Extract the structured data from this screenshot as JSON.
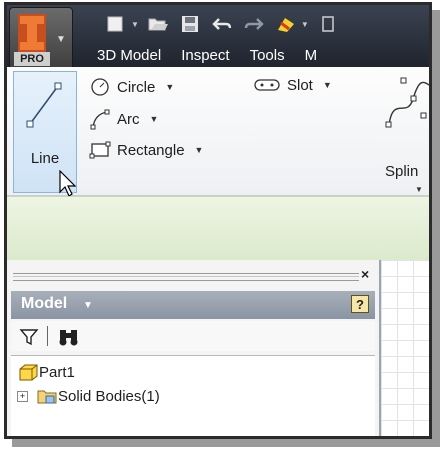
{
  "app": {
    "badge": "PRO",
    "logo_icon": "inventor-logo-icon"
  },
  "quick_access": [
    {
      "name": "new-icon"
    },
    {
      "name": "open-icon"
    },
    {
      "name": "save-icon"
    },
    {
      "name": "undo-icon"
    },
    {
      "name": "redo-icon"
    },
    {
      "name": "update-icon"
    },
    {
      "name": "more-icon"
    }
  ],
  "tabs": [
    "3D Model",
    "Inspect",
    "Tools",
    "M"
  ],
  "ribbon": {
    "line": "Line",
    "circle": "Circle",
    "arc": "Arc",
    "rectangle": "Rectangle",
    "slot": "Slot",
    "spline": "Splin"
  },
  "browser": {
    "title": "Model",
    "help": "?",
    "close": "×",
    "tree": [
      {
        "label": "Part1",
        "icon": "part-icon"
      },
      {
        "label": "Solid Bodies(1)",
        "icon": "solid-bodies-folder-icon",
        "expand": "+"
      }
    ]
  },
  "colors": {
    "accent": "#cfe3f6",
    "titlebar": "#2b313c",
    "pane_header": "#98a1ad",
    "logo": "#e3662a"
  }
}
